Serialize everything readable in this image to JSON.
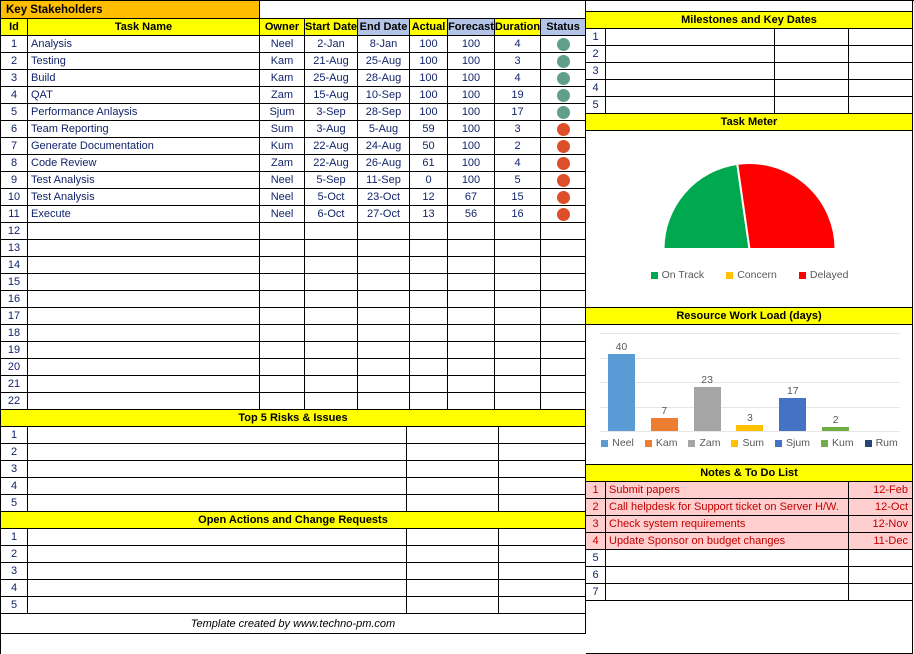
{
  "left": {
    "key_stakeholders_title": "Key Stakeholders",
    "task_table": {
      "headers": [
        "Id",
        "Task Name",
        "Owner",
        "Start Date",
        "End Date",
        "Actual",
        "Forecast",
        "Duration",
        "Status"
      ],
      "rows": [
        {
          "id": "1",
          "task": "Analysis",
          "owner": "Neel",
          "start": "2-Jan",
          "end": "8-Jan",
          "actual": "100",
          "forecast": "100",
          "duration": "4",
          "status": "green"
        },
        {
          "id": "2",
          "task": "Testing",
          "owner": "Kam",
          "start": "21-Aug",
          "end": "25-Aug",
          "actual": "100",
          "forecast": "100",
          "duration": "3",
          "status": "green"
        },
        {
          "id": "3",
          "task": "Build",
          "owner": "Kam",
          "start": "25-Aug",
          "end": "28-Aug",
          "actual": "100",
          "forecast": "100",
          "duration": "4",
          "status": "green"
        },
        {
          "id": "4",
          "task": "QAT",
          "owner": "Zam",
          "start": "15-Aug",
          "end": "10-Sep",
          "actual": "100",
          "forecast": "100",
          "duration": "19",
          "status": "green"
        },
        {
          "id": "5",
          "task": "Performance Anlaysis",
          "owner": "Sjum",
          "start": "3-Sep",
          "end": "28-Sep",
          "actual": "100",
          "forecast": "100",
          "duration": "17",
          "status": "green"
        },
        {
          "id": "6",
          "task": "Team Reporting",
          "owner": "Sum",
          "start": "3-Aug",
          "end": "5-Aug",
          "actual": "59",
          "forecast": "100",
          "duration": "3",
          "status": "red"
        },
        {
          "id": "7",
          "task": "Generate Documentation",
          "owner": "Kum",
          "start": "22-Aug",
          "end": "24-Aug",
          "actual": "50",
          "forecast": "100",
          "duration": "2",
          "status": "red"
        },
        {
          "id": "8",
          "task": "Code Review",
          "owner": "Zam",
          "start": "22-Aug",
          "end": "26-Aug",
          "actual": "61",
          "forecast": "100",
          "duration": "4",
          "status": "red"
        },
        {
          "id": "9",
          "task": "Test Analysis",
          "owner": "Neel",
          "start": "5-Sep",
          "end": "11-Sep",
          "actual": "0",
          "forecast": "100",
          "duration": "5",
          "status": "red"
        },
        {
          "id": "10",
          "task": "Test Analysis",
          "owner": "Neel",
          "start": "5-Oct",
          "end": "23-Oct",
          "actual": "12",
          "forecast": "67",
          "duration": "15",
          "status": "red"
        },
        {
          "id": "11",
          "task": "Execute",
          "owner": "Neel",
          "start": "6-Oct",
          "end": "27-Oct",
          "actual": "13",
          "forecast": "56",
          "duration": "16",
          "status": "red"
        },
        {
          "id": "12",
          "task": "",
          "owner": "",
          "start": "",
          "end": "",
          "actual": "",
          "forecast": "",
          "duration": "",
          "status": ""
        },
        {
          "id": "13",
          "task": "",
          "owner": "",
          "start": "",
          "end": "",
          "actual": "",
          "forecast": "",
          "duration": "",
          "status": ""
        },
        {
          "id": "14",
          "task": "",
          "owner": "",
          "start": "",
          "end": "",
          "actual": "",
          "forecast": "",
          "duration": "",
          "status": ""
        },
        {
          "id": "15",
          "task": "",
          "owner": "",
          "start": "",
          "end": "",
          "actual": "",
          "forecast": "",
          "duration": "",
          "status": ""
        },
        {
          "id": "16",
          "task": "",
          "owner": "",
          "start": "",
          "end": "",
          "actual": "",
          "forecast": "",
          "duration": "",
          "status": ""
        },
        {
          "id": "17",
          "task": "",
          "owner": "",
          "start": "",
          "end": "",
          "actual": "",
          "forecast": "",
          "duration": "",
          "status": ""
        },
        {
          "id": "18",
          "task": "",
          "owner": "",
          "start": "",
          "end": "",
          "actual": "",
          "forecast": "",
          "duration": "",
          "status": ""
        },
        {
          "id": "19",
          "task": "",
          "owner": "",
          "start": "",
          "end": "",
          "actual": "",
          "forecast": "",
          "duration": "",
          "status": ""
        },
        {
          "id": "20",
          "task": "",
          "owner": "",
          "start": "",
          "end": "",
          "actual": "",
          "forecast": "",
          "duration": "",
          "status": ""
        },
        {
          "id": "21",
          "task": "",
          "owner": "",
          "start": "",
          "end": "",
          "actual": "",
          "forecast": "",
          "duration": "",
          "status": ""
        },
        {
          "id": "22",
          "task": "",
          "owner": "",
          "start": "",
          "end": "",
          "actual": "",
          "forecast": "",
          "duration": "",
          "status": ""
        }
      ]
    },
    "risks": {
      "title": "Top 5 Risks & Issues",
      "rows": [
        {
          "id": "1",
          "a": "",
          "b": "",
          "c": ""
        },
        {
          "id": "2",
          "a": "",
          "b": "",
          "c": ""
        },
        {
          "id": "3",
          "a": "",
          "b": "",
          "c": ""
        },
        {
          "id": "4",
          "a": "",
          "b": "",
          "c": ""
        },
        {
          "id": "5",
          "a": "",
          "b": "",
          "c": ""
        }
      ]
    },
    "open_actions": {
      "title": "Open Actions and Change Requests",
      "rows": [
        {
          "id": "1",
          "a": "",
          "b": "",
          "c": ""
        },
        {
          "id": "2",
          "a": "",
          "b": "",
          "c": ""
        },
        {
          "id": "3",
          "a": "",
          "b": "",
          "c": ""
        },
        {
          "id": "4",
          "a": "",
          "b": "",
          "c": ""
        },
        {
          "id": "5",
          "a": "",
          "b": "",
          "c": ""
        }
      ]
    },
    "footer": "Template created by www.techno-pm.com"
  },
  "right": {
    "milestones": {
      "title": "Milestones and Key Dates",
      "rows": [
        {
          "id": "1",
          "a": "",
          "b": "",
          "c": ""
        },
        {
          "id": "2",
          "a": "",
          "b": "",
          "c": ""
        },
        {
          "id": "3",
          "a": "",
          "b": "",
          "c": ""
        },
        {
          "id": "4",
          "a": "",
          "b": "",
          "c": ""
        },
        {
          "id": "5",
          "a": "",
          "b": "",
          "c": ""
        }
      ]
    },
    "task_meter": {
      "title": "Task Meter"
    },
    "resource_load": {
      "title": "Resource Work Load (days)"
    },
    "notes": {
      "title": "Notes & To Do List",
      "rows": [
        {
          "id": "1",
          "text": "Submit papers",
          "date": "12-Feb",
          "filled": true
        },
        {
          "id": "2",
          "text": "Call helpdesk for Support ticket on Server H/W.",
          "date": "12-Oct",
          "filled": true
        },
        {
          "id": "3",
          "text": "Check system requirements",
          "date": "12-Nov",
          "filled": true
        },
        {
          "id": "4",
          "text": "Update Sponsor on budget changes",
          "date": "11-Dec",
          "filled": true
        },
        {
          "id": "5",
          "text": "",
          "date": "",
          "filled": false
        },
        {
          "id": "6",
          "text": "",
          "date": "",
          "filled": false
        },
        {
          "id": "7",
          "text": "",
          "date": "",
          "filled": false
        }
      ]
    }
  },
  "chart_data": [
    {
      "type": "pie",
      "title": "Task Meter",
      "subtype": "half-donut-gauge",
      "labels": [
        "On Track",
        "Concern",
        "Delayed"
      ],
      "values": [
        5,
        0,
        6
      ],
      "percents": [
        45.5,
        0,
        54.5
      ],
      "colors": [
        "#00a94f",
        "#ffc000",
        "#ff0000"
      ],
      "legend_position": "bottom"
    },
    {
      "type": "bar",
      "title": "Resource Work Load (days)",
      "categories": [
        "Neel",
        "Kam",
        "Zam",
        "Sum",
        "Sjum",
        "Kum",
        "Rum"
      ],
      "values": [
        40,
        7,
        23,
        3,
        17,
        2,
        0
      ],
      "colors": [
        "#5b9bd5",
        "#ed7d31",
        "#a5a5a5",
        "#ffc000",
        "#4472c4",
        "#70ad47",
        "#264478"
      ],
      "xlabel": "",
      "ylabel": "",
      "ylim": [
        0,
        50
      ],
      "grid": true,
      "data_labels": true,
      "legend_position": "bottom"
    }
  ],
  "colors": {
    "band_yellow": "#ffff00",
    "band_orange": "#ffbf00",
    "header_blue": "#b4c4e7",
    "status_green": "#60a08a",
    "status_red": "#dd4f28",
    "note_fill": "#ffcfcf",
    "note_text": "#c00000"
  }
}
